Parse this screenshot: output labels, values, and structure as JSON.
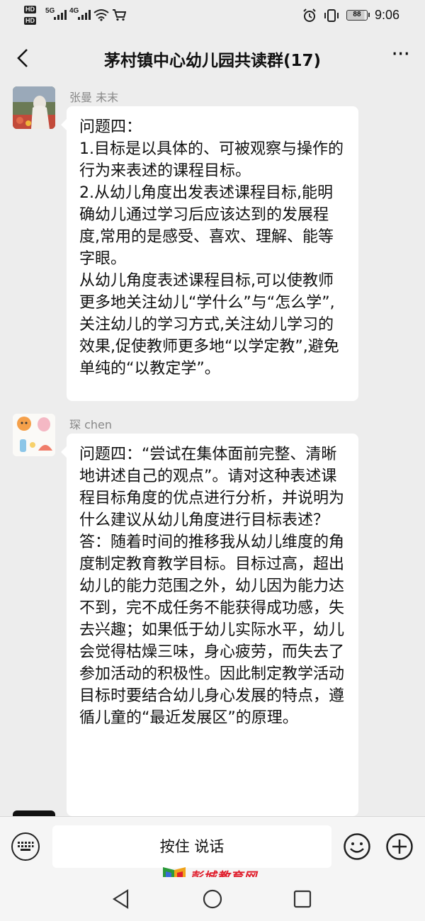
{
  "status_bar": {
    "hd1": "HD",
    "hd2": "HD",
    "net1": "5G",
    "net2": "4G",
    "battery": "88",
    "time": "9:06"
  },
  "nav": {
    "title": "茅村镇中心幼儿园共读群(17)",
    "more": "···"
  },
  "messages": [
    {
      "sender": "张曼  未末",
      "text": "问题四：\n1.目标是以具体的、可被观察与操作的行为来表述的课程目标。\n2.从幼儿角度出发表述课程目标,能明确幼儿通过学习后应该达到的发展程度,常用的是感受、喜欢、理解、能等字眼。\n从幼儿角度表述课程目标,可以使教师更多地关注幼儿“学什么”与“怎么学”,关注幼儿的学习方式,关注幼儿学习的效果,促使教师更多地“以学定教”,避免单纯的“以教定学”。"
    },
    {
      "sender": "琛  chen",
      "text": "问题四：“尝试在集体面前完整、清晰地讲述自己的观点”。请对这种表述课程目标角度的优点进行分析，并说明为什么建议从幼儿角度进行目标表述？\n答：随着时间的推移我从幼儿维度的角度制定教育教学目标。目标过高，超出幼儿的能力范围之外，幼儿因为能力达不到，完不成任务不能获得成功感，失去兴趣；如果低于幼儿实际水平，幼儿会觉得枯燥三味，身心疲劳，而失去了参加活动的积极性。因此制定教学活动目标时要结合幼儿身心发展的特点，遵循儿童的“最近发展区”的原理。"
    }
  ],
  "input_bar": {
    "hold_to_talk": "按住 说话"
  },
  "watermark": {
    "text": "彭城教育网"
  },
  "colors": {
    "background": "#ededed",
    "bubble": "#ffffff",
    "sender_gray": "#888888",
    "watermark_red": "#e01f2d"
  }
}
